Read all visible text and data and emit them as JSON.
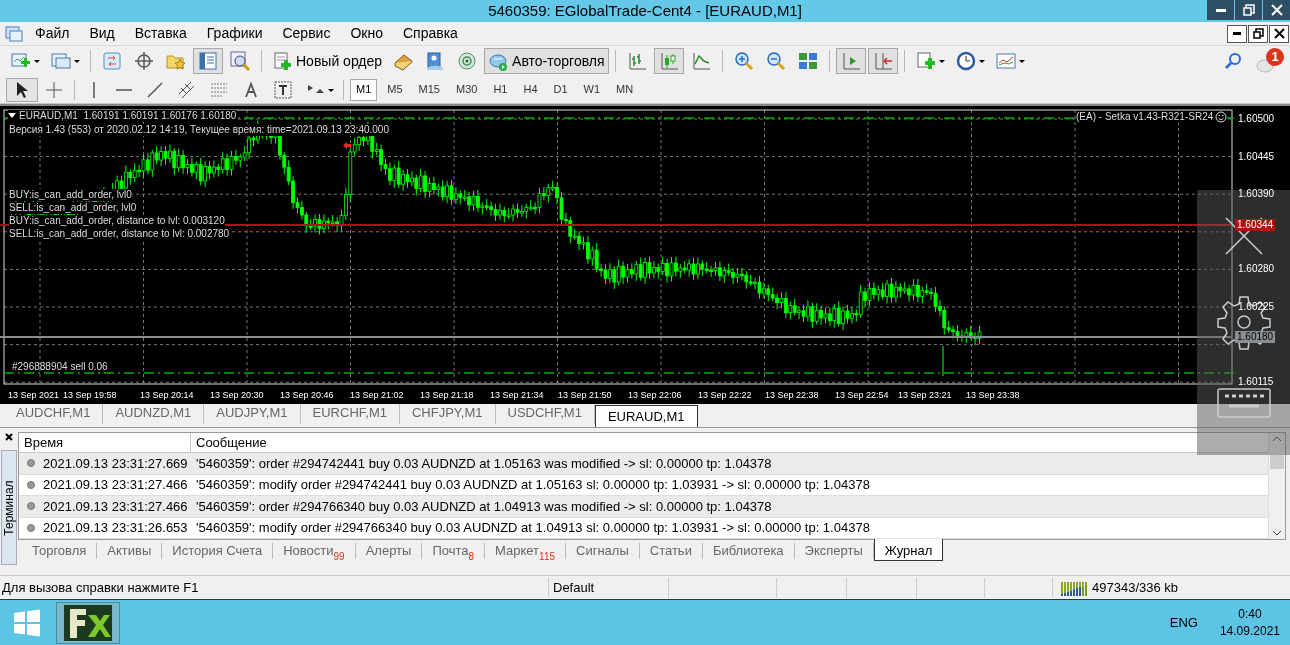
{
  "window": {
    "title": "5460359: EGlobalTrade-Cent4 - [EURAUD,M1]"
  },
  "menu": [
    "Файл",
    "Вид",
    "Вставка",
    "Графики",
    "Сервис",
    "Окно",
    "Справка"
  ],
  "toolbar_main": [
    {
      "kind": "icon",
      "pressed": false
    },
    {
      "kind": "icon",
      "pressed": false
    },
    {
      "kind": "separator"
    },
    {
      "kind": "icon",
      "pressed": false
    },
    {
      "kind": "icon",
      "pressed": false
    },
    {
      "kind": "icon",
      "pressed": false
    },
    {
      "kind": "icon",
      "pressed": true
    },
    {
      "kind": "icon",
      "pressed": false
    },
    {
      "kind": "separator"
    },
    {
      "kind": "text",
      "label": "Новый ордер",
      "pressed": false
    },
    {
      "kind": "icon",
      "pressed": false
    },
    {
      "kind": "icon",
      "pressed": false
    },
    {
      "kind": "icon",
      "pressed": false
    },
    {
      "kind": "text",
      "label": "Авто-торговля",
      "pressed": true
    },
    {
      "kind": "separator"
    },
    {
      "kind": "icon",
      "pressed": false
    },
    {
      "kind": "icon",
      "pressed": true
    },
    {
      "kind": "icon",
      "pressed": false
    },
    {
      "kind": "separator"
    },
    {
      "kind": "icon",
      "pressed": false
    },
    {
      "kind": "icon",
      "pressed": false
    },
    {
      "kind": "icon",
      "pressed": false
    },
    {
      "kind": "separator"
    },
    {
      "kind": "icon",
      "pressed": true
    },
    {
      "kind": "icon",
      "pressed": true
    },
    {
      "kind": "separator"
    },
    {
      "kind": "icon",
      "pressed": false
    },
    {
      "kind": "icon",
      "pressed": false
    },
    {
      "kind": "icon",
      "pressed": false
    }
  ],
  "notifications": {
    "count": "1"
  },
  "tools": [
    {
      "selected": true
    },
    {
      "selected": false
    },
    {
      "selected": false
    },
    {
      "selected": false
    },
    {
      "selected": false
    },
    {
      "selected": false
    },
    {
      "selected": false
    },
    {
      "selected": false
    },
    {
      "selected": false
    },
    {
      "selected": false
    }
  ],
  "timeframes": [
    {
      "label": "M1",
      "selected": true
    },
    {
      "label": "M5",
      "selected": false
    },
    {
      "label": "M15",
      "selected": false
    },
    {
      "label": "M30",
      "selected": false
    },
    {
      "label": "H1",
      "selected": false
    },
    {
      "label": "H4",
      "selected": false
    },
    {
      "label": "D1",
      "selected": false
    },
    {
      "label": "W1",
      "selected": false
    },
    {
      "label": "MN",
      "selected": false
    }
  ],
  "chart": {
    "legend": "EURAUD,M1  1.60191 1.60191 1.60176 1.60180",
    "version_line": "Версия 1.43 (553) от 2020.02.12 14:19, Текущее время:  time=2021.09.13 23:40.000",
    "info_lines": [
      "BUY:is_can_add_order, lvl0",
      "SELL:is_can_add_order, lvl0",
      "BUY:is_can_add_order, distance to lvl: 0.003120",
      "SELL:is_can_add_order, distance to lvl: 0.002780"
    ],
    "order_label": "#296888904 sell 0.06",
    "expert_label": "(EA) - Setka v1.43-R321-SR24",
    "price_ticks": [
      "1.60500",
      "1.60445",
      "1.60390",
      "1.60280",
      "1.60225",
      "1.60115"
    ],
    "price_markers": [
      {
        "kind": "alert",
        "label": "1.60344",
        "color": "#b01010"
      },
      {
        "kind": "order",
        "label": "1.60180",
        "color": "#8a8f94"
      }
    ],
    "time_ticks": [
      "13 Sep 2021",
      "13 Sep 19:58",
      "13 Sep 20:14",
      "13 Sep 20:30",
      "13 Sep 20:46",
      "13 Sep 21:02",
      "13 Sep 21:18",
      "13 Sep 21:34",
      "13 Sep 21:50",
      "13 Sep 22:06",
      "13 Sep 22:22",
      "13 Sep 22:38",
      "13 Sep 22:54",
      "13 Sep 23:21",
      "13 Sep 23:38"
    ]
  },
  "chart_tabs": [
    {
      "label": "AUDCHF,M1",
      "selected": false
    },
    {
      "label": "AUDNZD,M1",
      "selected": false
    },
    {
      "label": "AUDJPY,M1",
      "selected": false
    },
    {
      "label": "EURCHF,M1",
      "selected": false
    },
    {
      "label": "CHFJPY,M1",
      "selected": false
    },
    {
      "label": "USDCHF,M1",
      "selected": false
    },
    {
      "label": "EURAUD,M1",
      "selected": true
    }
  ],
  "terminal": {
    "title": "Терминал",
    "columns": [
      "Время",
      "Сообщение"
    ],
    "rows": [
      {
        "time": "2021.09.13 23:31:27.669",
        "message": "'5460359': order #294742441 buy 0.03 AUDNZD at 1.05163 was modified -> sl: 0.00000 tp: 1.04378"
      },
      {
        "time": "2021.09.13 23:31:27.466",
        "message": "'5460359': modify order #294742441 buy 0.03 AUDNZD at 1.05163 sl: 0.00000 tp: 1.03931 -> sl: 0.00000 tp: 1.04378"
      },
      {
        "time": "2021.09.13 23:31:27.466",
        "message": "'5460359': order #294766340 buy 0.03 AUDNZD at 1.04913 was modified -> sl: 0.00000 tp: 1.04378"
      },
      {
        "time": "2021.09.13 23:31:26.653",
        "message": "'5460359': modify order #294766340 buy 0.03 AUDNZD at 1.04913 sl: 0.00000 tp: 1.03931 -> sl: 0.00000 tp: 1.04378"
      }
    ],
    "tabs": [
      {
        "label": "Торговля",
        "selected": false
      },
      {
        "label": "Активы",
        "selected": false
      },
      {
        "label": "История Счета",
        "selected": false
      },
      {
        "label": "Новости",
        "badge": "99",
        "selected": false
      },
      {
        "label": "Алерты",
        "selected": false
      },
      {
        "label": "Почта",
        "badge": "8",
        "selected": false
      },
      {
        "label": "Маркет",
        "badge": "115",
        "selected": false
      },
      {
        "label": "Сигналы",
        "selected": false
      },
      {
        "label": "Статьи",
        "selected": false
      },
      {
        "label": "Библиотека",
        "selected": false
      },
      {
        "label": "Эксперты",
        "selected": false
      },
      {
        "label": "Журнал",
        "selected": true
      }
    ]
  },
  "status_bar": {
    "help": "Для вызова справки нажмите F1",
    "profile": "Default",
    "traffic": "497343/336 kb"
  },
  "taskbar": {
    "language": "ENG",
    "time": "0:40",
    "date": "14.09.2021"
  }
}
